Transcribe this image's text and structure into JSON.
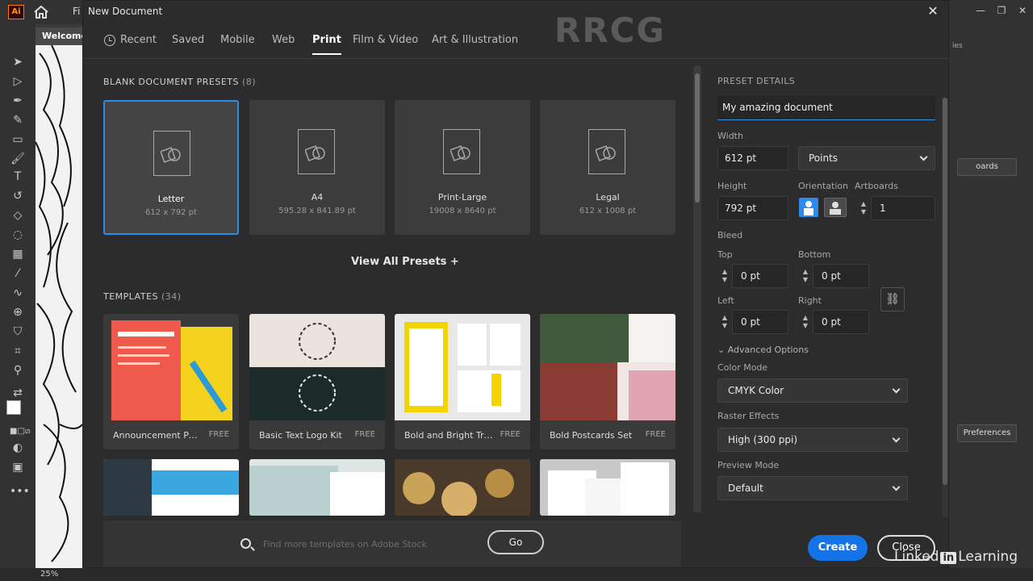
{
  "app": {
    "logo": "Ai",
    "menu_stub": "Fi",
    "doc_tab": "Welcome",
    "zoom": "25%",
    "right_panel": {
      "artboards_label": "oards",
      "preferences_label": "Preferences",
      "panel_stub": "ies"
    }
  },
  "dialog": {
    "title": "New Document",
    "tabs": [
      {
        "label": "Recent"
      },
      {
        "label": "Saved"
      },
      {
        "label": "Mobile"
      },
      {
        "label": "Web"
      },
      {
        "label": "Print",
        "active": true
      },
      {
        "label": "Film & Video"
      },
      {
        "label": "Art & Illustration"
      }
    ],
    "presets": {
      "title": "BLANK DOCUMENT PRESETS",
      "count": "(8)",
      "items": [
        {
          "name": "Letter",
          "size": "612 x 792 pt",
          "selected": true
        },
        {
          "name": "A4",
          "size": "595.28 x 841.89 pt"
        },
        {
          "name": "Print-Large",
          "size": "19008 x 8640 pt"
        },
        {
          "name": "Legal",
          "size": "612 x 1008 pt"
        }
      ],
      "view_all": "View All Presets +"
    },
    "templates": {
      "title": "TEMPLATES",
      "count": "(34)",
      "items": [
        {
          "name": "Announcement Post...",
          "badge": "FREE"
        },
        {
          "name": "Basic Text Logo Kit",
          "badge": "FREE"
        },
        {
          "name": "Bold and Bright Trifol...",
          "badge": "FREE"
        },
        {
          "name": "Bold Postcards Set",
          "badge": "FREE"
        }
      ]
    },
    "search": {
      "placeholder": "Find more templates on Adobe Stock",
      "go_label": "Go"
    },
    "details": {
      "title": "PRESET DETAILS",
      "doc_name": "My amazing document",
      "width_label": "Width",
      "width": "612 pt",
      "units": "Points",
      "height_label": "Height",
      "height": "792 pt",
      "orientation_label": "Orientation",
      "artboards_label": "Artboards",
      "artboards": "1",
      "bleed_label": "Bleed",
      "top_label": "Top",
      "top": "0 pt",
      "bottom_label": "Bottom",
      "bottom": "0 pt",
      "left_label": "Left",
      "left": "0 pt",
      "right_label": "Right",
      "right": "0 pt",
      "advanced_label": "Advanced Options",
      "color_mode_label": "Color Mode",
      "color_mode": "CMYK Color",
      "raster_label": "Raster Effects",
      "raster": "High (300 ppi)",
      "preview_label": "Preview Mode",
      "preview": "Default"
    },
    "buttons": {
      "create": "Create",
      "close": "Close"
    }
  },
  "branding": {
    "linkedin_pre": "Linked",
    "linkedin_in": "in",
    "linkedin_post": "Learning",
    "watermark": "RRCG"
  },
  "colors": {
    "accent": "#1473e6",
    "selected_border": "#2d8ceb",
    "dialog_bg": "#2c2c2c"
  }
}
